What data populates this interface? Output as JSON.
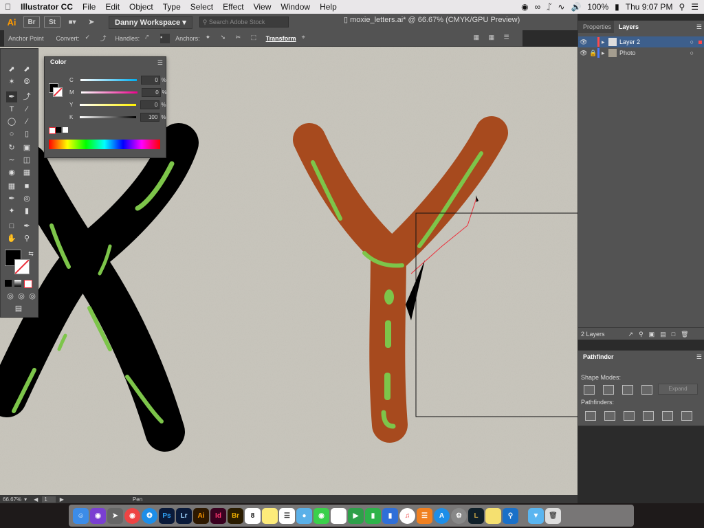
{
  "menubar": {
    "app_name": "Illustrator CC",
    "items": [
      "File",
      "Edit",
      "Object",
      "Type",
      "Select",
      "Effect",
      "View",
      "Window",
      "Help"
    ],
    "battery": "100%",
    "clock": "Thu 9:07 PM"
  },
  "appbar": {
    "logo": "Ai",
    "bridge": "Br",
    "stock": "St",
    "workspace": "Danny Workspace",
    "search_placeholder": "Search Adobe Stock",
    "document_title": "moxie_letters.ai* @ 66.67% (CMYK/GPU Preview)"
  },
  "controlbar": {
    "anchor_point": "Anchor Point",
    "convert": "Convert:",
    "handles": "Handles:",
    "anchors": "Anchors:",
    "transform": "Transform"
  },
  "color_panel": {
    "title": "Color",
    "channels": [
      {
        "label": "C",
        "value": "0",
        "unit": "%",
        "color": "#00aeef"
      },
      {
        "label": "M",
        "value": "0",
        "unit": "%",
        "color": "#ec008c"
      },
      {
        "label": "Y",
        "value": "0",
        "unit": "%",
        "color": "#fff200"
      },
      {
        "label": "K",
        "value": "100",
        "unit": "%",
        "color": "#000000"
      }
    ]
  },
  "layers_panel": {
    "tabs": [
      "Properties",
      "Layers"
    ],
    "active_tab": "Layers",
    "layers": [
      {
        "name": "Layer 2",
        "color": "#ff4a4a",
        "selected": true
      },
      {
        "name": "Photo",
        "color": "#4a7bff",
        "selected": false
      }
    ],
    "footer_count": "2 Layers"
  },
  "pathfinder_panel": {
    "title": "Pathfinder",
    "shape_modes_label": "Shape Modes:",
    "pathfinders_label": "Pathfinders:",
    "expand_label": "Expand"
  },
  "statusbar": {
    "zoom": "66.67%",
    "artboard": "1",
    "tool": "Pen"
  },
  "dock": {
    "apps": [
      "Finder",
      "Siri",
      "Launchpad",
      "Chrome",
      "Safari",
      "Ps",
      "Lr",
      "Ai",
      "Id",
      "Br",
      "Calendar",
      "Notes",
      "Reminders",
      "Photos",
      "Messages",
      "FaceTime",
      "Numbers",
      "Keynote",
      "iTunes",
      "iBooks",
      "App Store",
      "Preferences",
      "League",
      "Stickies",
      "Preview",
      "Downloads",
      "Trash"
    ],
    "calendar_day": "8"
  },
  "colors": {
    "accent_red": "#ec2e3a",
    "panel_bg": "#535353",
    "letter_brown": "#a74a1e",
    "highlight_green": "#7dc54a"
  }
}
